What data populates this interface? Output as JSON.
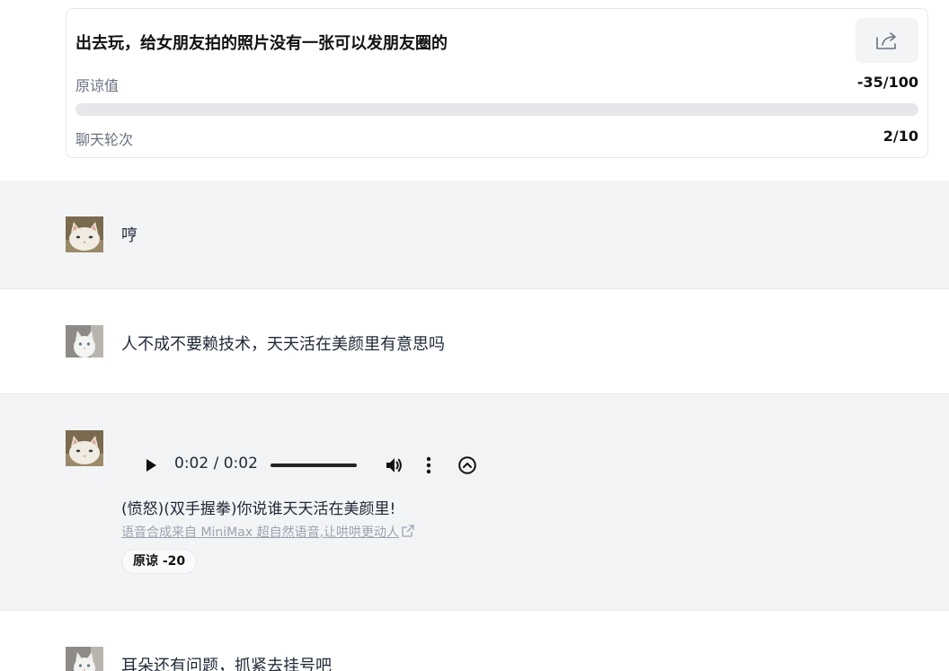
{
  "scenario": {
    "title": "出去玩，给女朋友拍的照片没有一张可以发朋友圈的",
    "share_icon": "share-icon",
    "forgiveness_label": "原谅值",
    "forgiveness_value": "-35/100",
    "forgiveness_progress": 0,
    "rounds_label": "聊天轮次",
    "rounds_value": "2/10"
  },
  "messages": [
    {
      "role": "girlfriend",
      "avatar": "cat-avatar-cream",
      "text": "哼"
    },
    {
      "role": "user",
      "avatar": "cat-avatar-white",
      "text": "人不成不要赖技术，天天活在美颜里有意思吗"
    },
    {
      "role": "girlfriend",
      "avatar": "cat-avatar-cream",
      "audio_time": "0:02 / 0:02",
      "text": "(愤怒)(双手握拳)你说谁天天活在美颜里!",
      "tts_link": "语音合成来自 MiniMax 超自然语音,让哄哄更动人",
      "badge": "原谅 -20"
    },
    {
      "role": "user",
      "avatar": "cat-avatar-white",
      "text": "耳朵还有问题，抓紧去挂号吧"
    }
  ],
  "colors": {
    "gray_row": "#f3f4f6",
    "border": "#e5e7eb",
    "muted": "#9ca3af"
  }
}
